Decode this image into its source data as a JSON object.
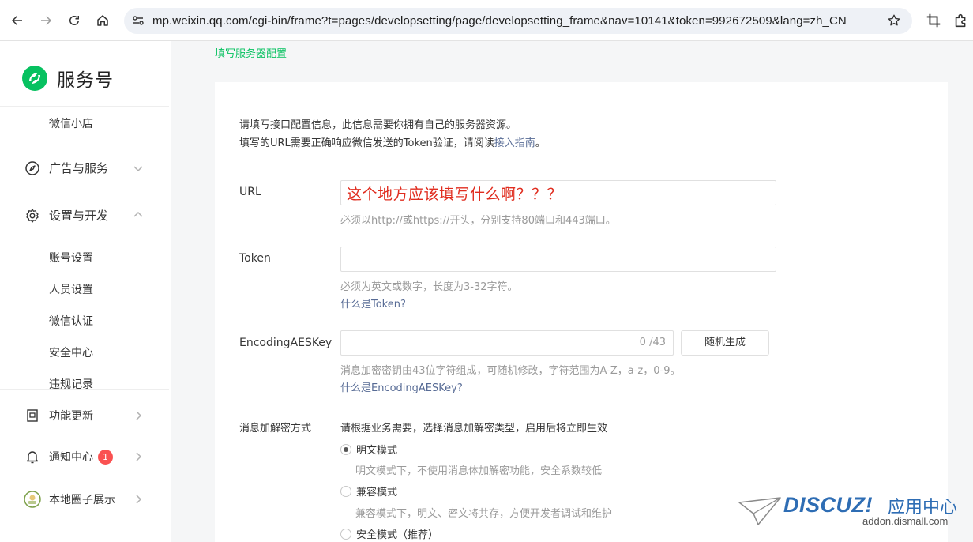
{
  "browser": {
    "url": "mp.weixin.qq.com/cgi-bin/frame?t=pages/developsetting/page/developsetting_frame&nav=10141&token=992672509&lang=zh_CN"
  },
  "brand": {
    "name": "服务号"
  },
  "sidebar": {
    "top_sub": "微信小店",
    "groups": [
      {
        "label": "广告与服务",
        "icon": "compass-icon"
      },
      {
        "label": "设置与开发",
        "icon": "gear-icon"
      }
    ],
    "sub_items": [
      "账号设置",
      "人员设置",
      "微信认证",
      "安全中心",
      "违规记录"
    ],
    "bottom": [
      {
        "label": "功能更新",
        "icon": "document-icon"
      },
      {
        "label": "通知中心",
        "icon": "bell-icon",
        "badge": "1"
      },
      {
        "label": "本地圈子展示",
        "icon": "circle-avatar-icon"
      }
    ]
  },
  "main": {
    "breadcrumb": "填写服务器配置",
    "intro_line1": "请填写接口配置信息，此信息需要你拥有自己的服务器资源。",
    "intro_line2_prefix": "填写的URL需要正确响应微信发送的Token验证，请阅读",
    "intro_line2_link": "接入指南",
    "intro_line2_suffix": "。",
    "url_field": {
      "label": "URL",
      "value": "这个地方应该填写什么啊？？？",
      "tip": "必须以http://或https://开头，分别支持80端口和443端口。"
    },
    "token_field": {
      "label": "Token",
      "value": "",
      "tip": "必须为英文或数字，长度为3-32字符。",
      "link": "什么是Token?"
    },
    "aes_field": {
      "label": "EncodingAESKey",
      "counter": "0 /43",
      "button": "随机生成",
      "tip": "消息加密密钥由43位字符组成，可随机修改，字符范围为A-Z，a-z，0-9。",
      "link": "什么是EncodingAESKey?"
    },
    "encrypt": {
      "label": "消息加解密方式",
      "desc": "请根据业务需要，选择消息加解密类型，启用后将立即生效",
      "options": [
        {
          "label": "明文模式",
          "desc": "明文模式下，不使用消息体加解密功能，安全系数较低",
          "selected": true
        },
        {
          "label": "兼容模式",
          "desc": "兼容模式下，明文、密文将共存，方便开发者调试和维护",
          "selected": false
        },
        {
          "label": "安全模式（推荐）",
          "desc": "",
          "selected": false
        }
      ]
    }
  },
  "watermark": {
    "logo": "DISCUZ!",
    "cn": "应用中心",
    "sub": "addon.dismall.com"
  },
  "colors": {
    "accent": "#07c160",
    "link": "#576b95",
    "annotation": "#e02d1f",
    "badge": "#fa5151"
  }
}
